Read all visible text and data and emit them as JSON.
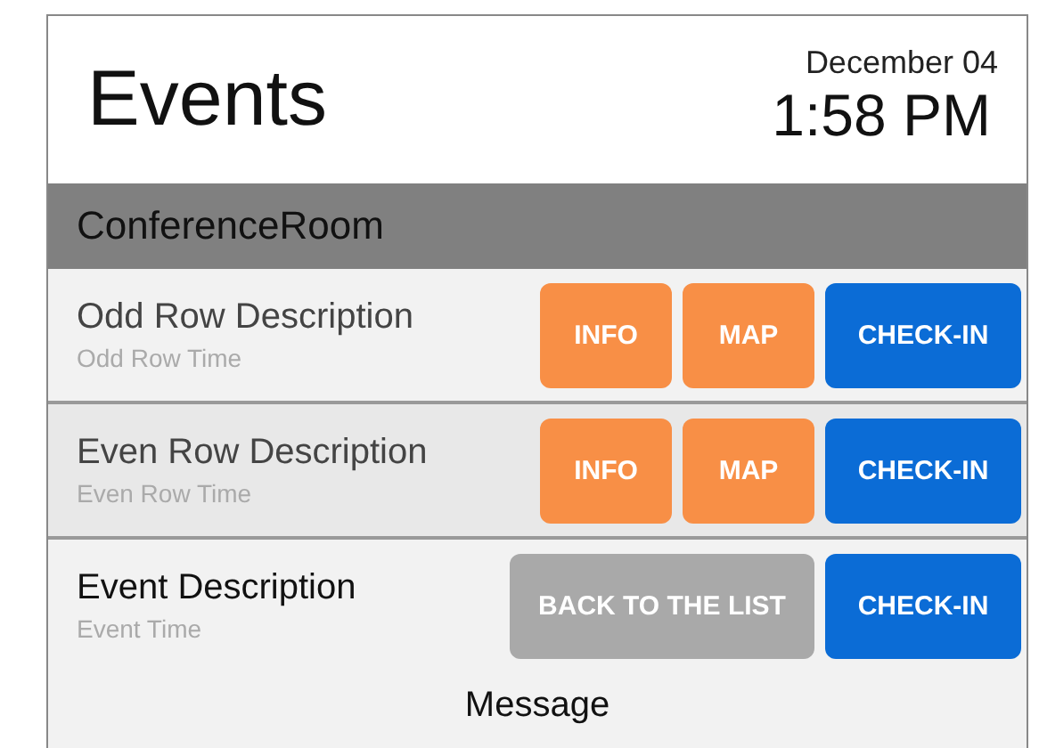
{
  "header": {
    "title": "Events",
    "date": "December 04",
    "time": "1:58 PM"
  },
  "room": {
    "name": "ConferenceRoom"
  },
  "rows": [
    {
      "kind": "odd",
      "description": "Odd Row Description",
      "time": "Odd Row Time",
      "buttons": [
        {
          "label": "INFO",
          "kind": "info"
        },
        {
          "label": "MAP",
          "kind": "map"
        },
        {
          "label": "CHECK-IN",
          "kind": "checkin"
        }
      ]
    },
    {
      "kind": "even",
      "description": "Even Row Description",
      "time": "Even Row Time",
      "buttons": [
        {
          "label": "INFO",
          "kind": "info"
        },
        {
          "label": "MAP",
          "kind": "map"
        },
        {
          "label": "CHECK-IN",
          "kind": "checkin"
        }
      ]
    },
    {
      "kind": "detail",
      "description": "Event Description",
      "time": "Event Time",
      "buttons": [
        {
          "label": "BACK TO THE LIST",
          "kind": "back"
        },
        {
          "label": "CHECK-IN",
          "kind": "checkin"
        }
      ]
    }
  ],
  "message": "Message"
}
